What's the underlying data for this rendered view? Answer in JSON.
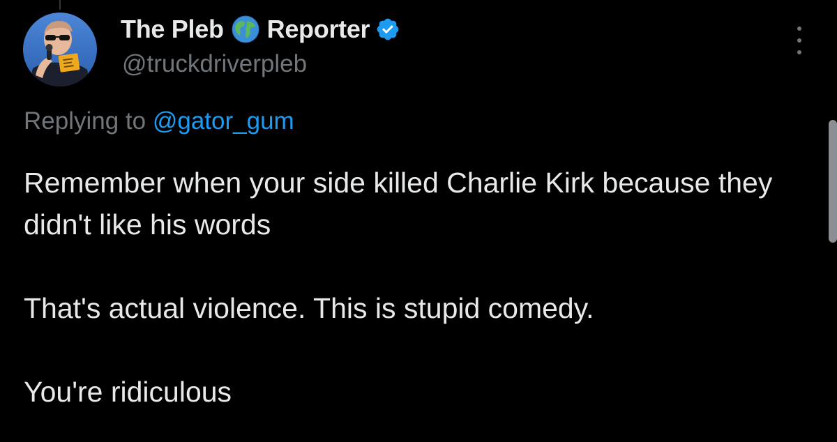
{
  "author": {
    "name_part1": "The Pleb",
    "name_part2": "Reporter",
    "handle": "@truckdriverpleb",
    "emoji_icon": "globe-icon",
    "verified_icon": "verified-badge-icon",
    "verified_color": "#1d9bf0"
  },
  "reply_context": {
    "prefix": "Replying to",
    "mention": "@gator_gum"
  },
  "tweet": {
    "lines": [
      "Remember when your side killed Charlie Kirk because they didn't like his words",
      "That's actual violence. This is stupid comedy.",
      "You're ridiculous"
    ]
  },
  "colors": {
    "background": "#000000",
    "text": "#e7e9ea",
    "secondary": "#71767b",
    "link": "#1d9bf0"
  }
}
